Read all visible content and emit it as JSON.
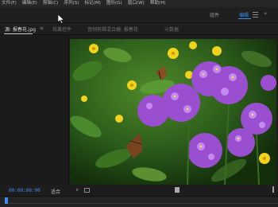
{
  "menubar": {
    "items": [
      "文件(F)",
      "编辑(E)",
      "剪辑(C)",
      "序列(S)",
      "标记(M)",
      "图形(G)",
      "窗口(W)",
      "帮助(H)"
    ]
  },
  "workspaces": {
    "items": [
      "组件",
      "编辑"
    ],
    "active": "编辑"
  },
  "tabs": {
    "active_label": "源: 报春花.jpg",
    "items": [
      "效果控件",
      "音频剪辑混合器: 报春花",
      "元数据"
    ]
  },
  "controls": {
    "timecode": "00:00:00:00",
    "fit_label": "适合"
  },
  "colors": {
    "accent": "#3d8df0",
    "panel": "#1d1d1d"
  },
  "icons": [
    "cursor-icon",
    "hamburger-menu-icon",
    "chevron-right-icon",
    "chevron-down-icon",
    "settings-wrench-icon"
  ]
}
